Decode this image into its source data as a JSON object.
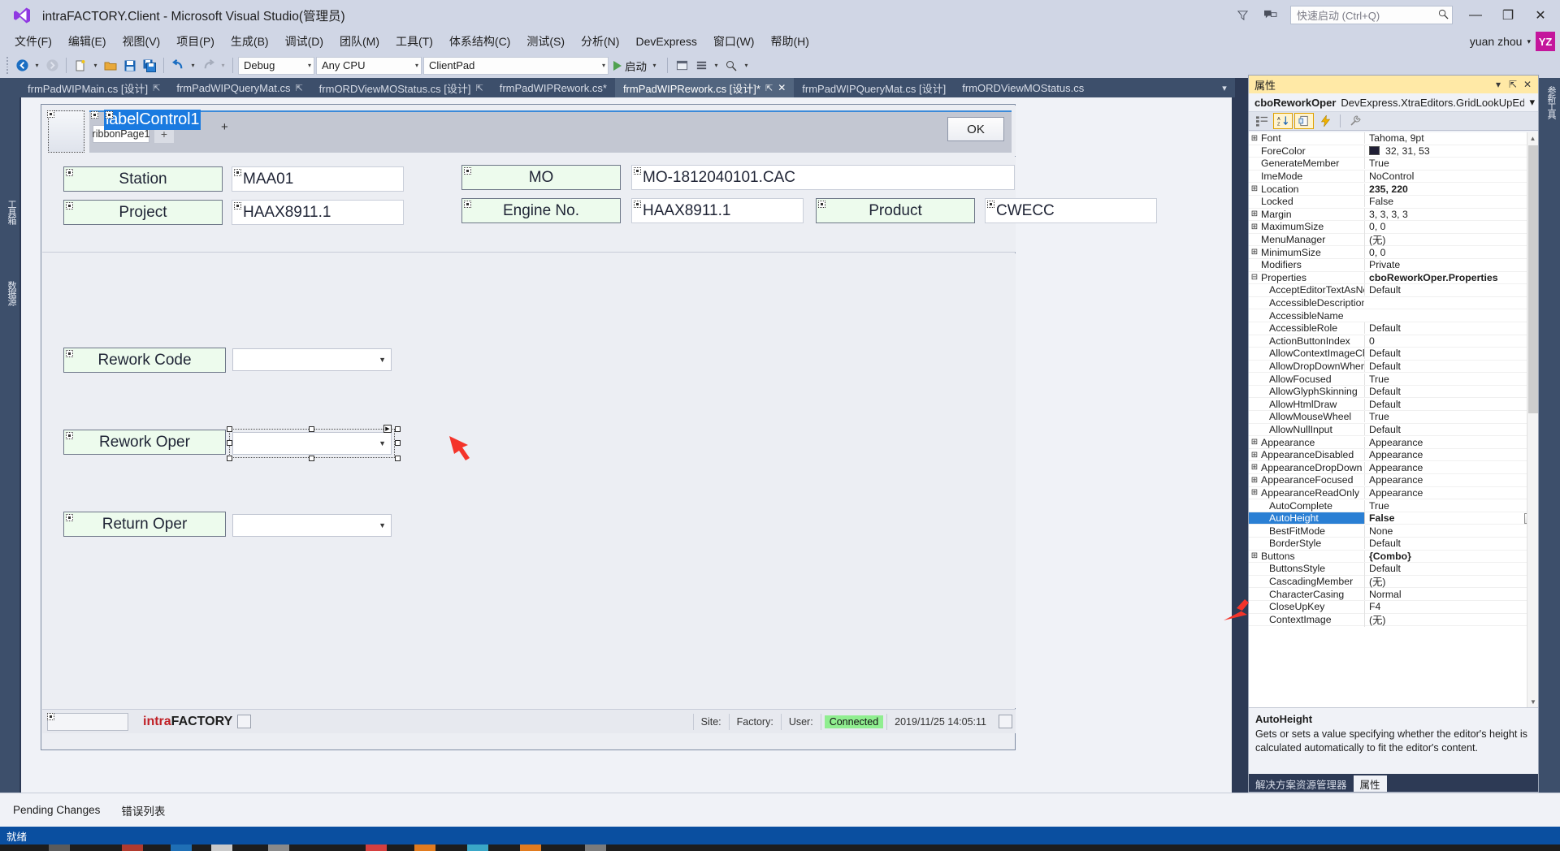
{
  "window": {
    "title": "intraFACTORY.Client - Microsoft Visual Studio(管理员)",
    "logo_icon": "visual-studio-logo",
    "minimize_label": "—",
    "maximize_label": "❐",
    "close_label": "✕"
  },
  "quick_launch": {
    "placeholder": "快速启动 (Ctrl+Q)",
    "icon": "search-icon",
    "feedback_icon": "feedback-icon",
    "filter_icon": "funnel-icon"
  },
  "account": {
    "name": "yuan zhou",
    "caret": "▾",
    "initials": "YZ"
  },
  "menu": {
    "items": [
      "文件(F)",
      "编辑(E)",
      "视图(V)",
      "项目(P)",
      "生成(B)",
      "调试(D)",
      "团队(M)",
      "工具(T)",
      "体系结构(C)",
      "测试(S)",
      "分析(N)",
      "DevExpress",
      "窗口(W)",
      "帮助(H)"
    ]
  },
  "toolbar": {
    "nav_back_icon": "nav-back-icon",
    "nav_forward_icon": "nav-forward-icon",
    "new_item_icon": "new-item-icon",
    "open_icon": "open-folder-icon",
    "save_icon": "save-icon",
    "save_all_icon": "save-all-icon",
    "undo_icon": "undo-icon",
    "redo_icon": "redo-icon",
    "configuration": "Debug",
    "platform": "Any CPU",
    "startup_project": "ClientPad",
    "start_label": "启动",
    "start_icon": "play-icon",
    "search_icon": "search-icon",
    "window_icon": "window-icon",
    "list_icon": "list-icon"
  },
  "left_dock": {
    "tabs": [
      "工具箱",
      "数据源"
    ]
  },
  "right_dock": {
    "tabs": [
      "参新工具"
    ]
  },
  "document_tabs": [
    {
      "label": "frmPadWIPMain.cs [设计]",
      "pin": "⇱",
      "state": "inactive"
    },
    {
      "label": "frmPadWIPQueryMat.cs",
      "pin": "⇱",
      "state": "inactive"
    },
    {
      "label": "frmORDViewMOStatus.cs [设计]",
      "pin": "⇱",
      "state": "inactive"
    },
    {
      "label": "frmPadWIPRework.cs*",
      "pin": "",
      "state": "inactive"
    },
    {
      "label": "frmPadWIPRework.cs [设计]*",
      "pin": "⇱",
      "close": "✕",
      "state": "active"
    },
    {
      "label": "frmPadWIPQueryMat.cs [设计]",
      "pin": "",
      "state": "inactive"
    },
    {
      "label": "frmORDViewMOStatus.cs",
      "pin": "",
      "state": "inactive"
    }
  ],
  "tab_overflow_icon": "chevron-down-icon",
  "designer": {
    "ribbon_page_label": "ribbonPage1",
    "ribbon_page_add": "+",
    "selected_label_text": "labelControl1",
    "selected_label_plus": "+",
    "ok_button": "OK",
    "header_fields": [
      {
        "label": "Station",
        "value": "MAA01"
      },
      {
        "label": "MO",
        "value": "MO-1812040101.CAC"
      },
      {
        "label": "Project",
        "value": "HAAX8911.1"
      },
      {
        "label": "Engine No.",
        "value": "HAAX8911.1"
      },
      {
        "label": "Product",
        "value": "CWECC"
      }
    ],
    "body_fields": [
      {
        "label": "Rework Code",
        "value": "",
        "selected": false
      },
      {
        "label": "Rework Oper",
        "value": "",
        "selected": true
      },
      {
        "label": "Return Oper",
        "value": "",
        "selected": false
      }
    ],
    "status": {
      "brand_intra": "intra",
      "brand_factory": "FACTORY",
      "site_label": "Site:",
      "factory_label": "Factory:",
      "user_label": "User:",
      "connection": "Connected",
      "connection_color": "#90ee90",
      "timestamp": "2019/11/25 14:05:11"
    }
  },
  "properties_panel": {
    "title": "属性",
    "dropdown_icon": "chevron-down-icon",
    "pin_icon": "pin-icon",
    "close_icon": "close-icon",
    "object_name": "cboReworkOper",
    "object_type": "DevExpress.XtraEditors.GridLookUpEdit",
    "object_caret": "▾",
    "toolbar": {
      "categorized_icon": "categorized-icon",
      "alphabetical_icon": "sort-az-icon",
      "properties_icon": "properties-page-icon",
      "events_icon": "events-lightning-icon",
      "propertypages_icon": "wrench-icon"
    },
    "rows": [
      {
        "expander": "⊞",
        "name": "Font",
        "value": "Tahoma, 9pt",
        "indent": false
      },
      {
        "expander": "",
        "name": "ForeColor",
        "value": "32, 31, 53",
        "swatch": "#201f35",
        "indent": false
      },
      {
        "expander": "",
        "name": "GenerateMember",
        "value": "True",
        "indent": false
      },
      {
        "expander": "",
        "name": "ImeMode",
        "value": "NoControl",
        "indent": false
      },
      {
        "expander": "⊞",
        "name": "Location",
        "value": "235, 220",
        "bold": true,
        "indent": false
      },
      {
        "expander": "",
        "name": "Locked",
        "value": "False",
        "indent": false
      },
      {
        "expander": "⊞",
        "name": "Margin",
        "value": "3, 3, 3, 3",
        "indent": false
      },
      {
        "expander": "⊞",
        "name": "MaximumSize",
        "value": "0, 0",
        "indent": false
      },
      {
        "expander": "",
        "name": "MenuManager",
        "value": "(无)",
        "indent": false
      },
      {
        "expander": "⊞",
        "name": "MinimumSize",
        "value": "0, 0",
        "indent": false
      },
      {
        "expander": "",
        "name": "Modifiers",
        "value": "Private",
        "indent": false
      },
      {
        "expander": "⊟",
        "name": "Properties",
        "value": "cboReworkOper.Properties",
        "bold": true,
        "indent": false
      },
      {
        "expander": "",
        "name": "AcceptEditorTextAsNew",
        "value": "Default",
        "indent": true
      },
      {
        "expander": "",
        "name": "AccessibleDescription",
        "value": "",
        "indent": true
      },
      {
        "expander": "",
        "name": "AccessibleName",
        "value": "",
        "indent": true
      },
      {
        "expander": "",
        "name": "AccessibleRole",
        "value": "Default",
        "indent": true
      },
      {
        "expander": "",
        "name": "ActionButtonIndex",
        "value": "0",
        "indent": true
      },
      {
        "expander": "",
        "name": "AllowContextImageCha",
        "value": "Default",
        "indent": true
      },
      {
        "expander": "",
        "name": "AllowDropDownWhenR",
        "value": "Default",
        "indent": true
      },
      {
        "expander": "",
        "name": "AllowFocused",
        "value": "True",
        "indent": true
      },
      {
        "expander": "",
        "name": "AllowGlyphSkinning",
        "value": "Default",
        "indent": true
      },
      {
        "expander": "",
        "name": "AllowHtmlDraw",
        "value": "Default",
        "indent": true
      },
      {
        "expander": "",
        "name": "AllowMouseWheel",
        "value": "True",
        "indent": true
      },
      {
        "expander": "",
        "name": "AllowNullInput",
        "value": "Default",
        "indent": true
      },
      {
        "expander": "⊞",
        "name": "Appearance",
        "value": "Appearance",
        "indent": false
      },
      {
        "expander": "⊞",
        "name": "AppearanceDisabled",
        "value": "Appearance",
        "indent": false
      },
      {
        "expander": "⊞",
        "name": "AppearanceDropDown",
        "value": "Appearance",
        "indent": false
      },
      {
        "expander": "⊞",
        "name": "AppearanceFocused",
        "value": "Appearance",
        "indent": false
      },
      {
        "expander": "⊞",
        "name": "AppearanceReadOnly",
        "value": "Appearance",
        "indent": false
      },
      {
        "expander": "",
        "name": "AutoComplete",
        "value": "True",
        "indent": true
      },
      {
        "expander": "",
        "name": "AutoHeight",
        "value": "False",
        "indent": true,
        "selected": true,
        "bold": true,
        "editor": "dropdown"
      },
      {
        "expander": "",
        "name": "BestFitMode",
        "value": "None",
        "indent": true
      },
      {
        "expander": "",
        "name": "BorderStyle",
        "value": "Default",
        "indent": true
      },
      {
        "expander": "⊞",
        "name": "Buttons",
        "value": "{Combo}",
        "bold": true,
        "indent": false
      },
      {
        "expander": "",
        "name": "ButtonsStyle",
        "value": "Default",
        "indent": true
      },
      {
        "expander": "",
        "name": "CascadingMember",
        "value": "(无)",
        "indent": true
      },
      {
        "expander": "",
        "name": "CharacterCasing",
        "value": "Normal",
        "indent": true
      },
      {
        "expander": "",
        "name": "CloseUpKey",
        "value": "F4",
        "indent": true
      },
      {
        "expander": "",
        "name": "ContextImage",
        "value": "(无)",
        "indent": true
      }
    ],
    "description": {
      "title": "AutoHeight",
      "text": "Gets or sets a value specifying whether the editor's height is calculated automatically to fit the editor's content."
    },
    "tabs": [
      {
        "label": "解决方案资源管理器",
        "active": false
      },
      {
        "label": "属性",
        "active": true
      }
    ],
    "scroll_up_icon": "chevron-up-icon",
    "scroll_down_icon": "chevron-down-icon"
  },
  "bottom_bar": {
    "items": [
      "Pending Changes",
      "错误列表"
    ]
  },
  "status_bar": {
    "text": "就绪"
  }
}
